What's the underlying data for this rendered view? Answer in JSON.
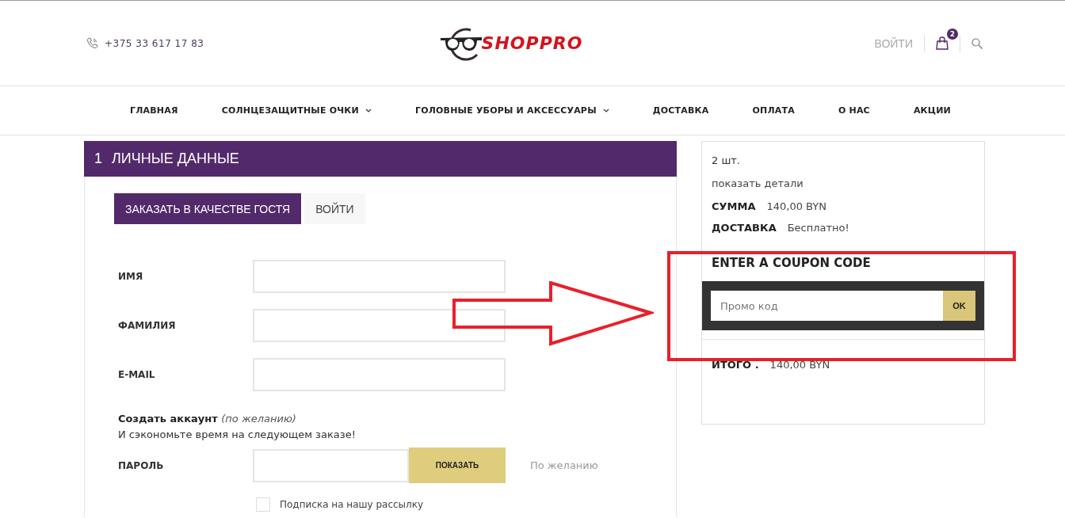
{
  "header": {
    "phone": "+375 33 617 17 83",
    "logo_text": "SHOPPRO",
    "login": "ВОЙТИ",
    "cart_count": "2"
  },
  "nav": [
    {
      "label": "ГЛАВНАЯ",
      "has_dropdown": false
    },
    {
      "label": "СОЛНЦЕЗАЩИТНЫЕ ОЧКИ",
      "has_dropdown": true
    },
    {
      "label": "ГОЛОВНЫЕ УБОРЫ И АКСЕССУАРЫ",
      "has_dropdown": true
    },
    {
      "label": "ДОСТАВКА",
      "has_dropdown": false
    },
    {
      "label": "ОПЛАТА",
      "has_dropdown": false
    },
    {
      "label": "О НАС",
      "has_dropdown": false
    },
    {
      "label": "АКЦИИ",
      "has_dropdown": false
    }
  ],
  "section": {
    "number": "1",
    "title": "ЛИЧНЫЕ ДАННЫЕ"
  },
  "tabs": [
    {
      "label": "ЗАКАЗАТЬ В КАЧЕСТВЕ ГОСТЯ",
      "selected": true
    },
    {
      "label": "ВОЙТИ",
      "selected": false
    }
  ],
  "fields": [
    {
      "label": "ИМЯ"
    },
    {
      "label": "ФАМИЛИЯ"
    },
    {
      "label": "E-MAIL"
    }
  ],
  "create_account": {
    "title": "Создать аккаунт *(по желанию)*",
    "subtitle": "И сэкономьте время на следующем заказе!"
  },
  "password": {
    "label": "ПАРОЛЬ",
    "button": "ПОКАЗАТЬ",
    "hint": "По желанию"
  },
  "newsletter": {
    "label": "Подписка на нашу рассылку",
    "checked": false
  },
  "summary": {
    "count": "2 шт.",
    "details_link": "показать детали",
    "rows": [
      {
        "label": "СУММА",
        "value": "140,00 BYN"
      },
      {
        "label": "ДОСТАВКА",
        "value": "Бесплатно!"
      }
    ],
    "coupon_title": "ENTER A COUPON CODE",
    "coupon_placeholder": "Промо код",
    "coupon_button": "OK",
    "total_label": "ИТОГО .",
    "total_value": "140,00 BYN"
  }
}
